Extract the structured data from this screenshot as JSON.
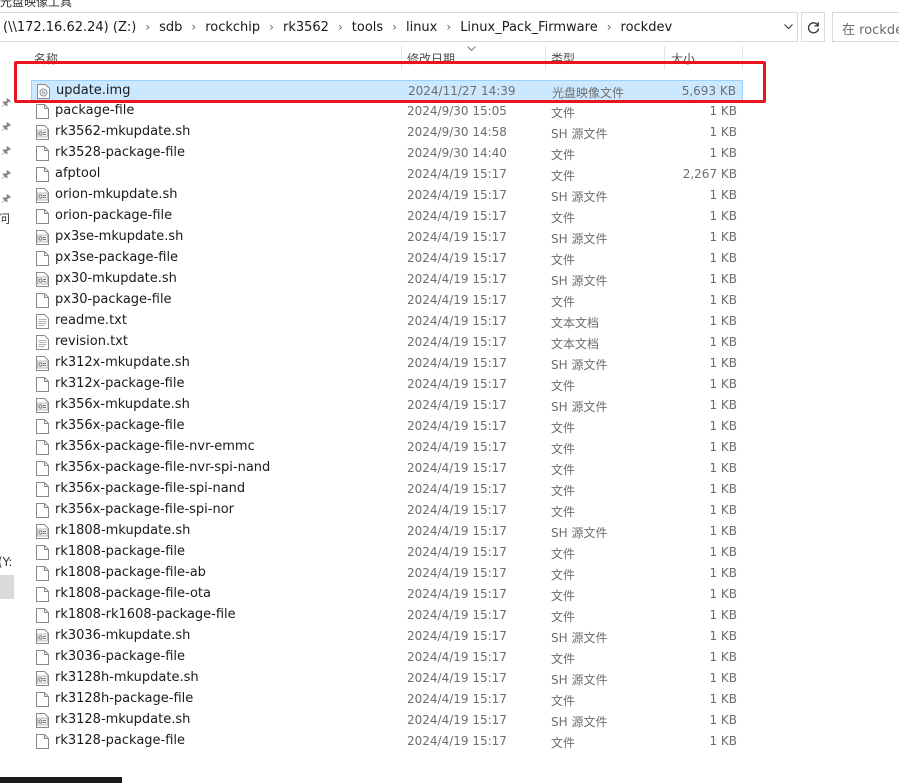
{
  "address_bar": {
    "crumbs": [
      "(\\\\172.16.62.24) (Z:)",
      "sdb",
      "rockchip",
      "rk3562",
      "tools",
      "linux",
      "Linux_Pack_Firmware",
      "rockdev"
    ],
    "search_placeholder": "在 rockdev 中搜索"
  },
  "top_cut_text": "光盘映像工具",
  "left_cut_texts": [
    "问",
    "(Y:"
  ],
  "columns": {
    "name": "名称",
    "date": "修改日期",
    "type": "类型",
    "size": "大小"
  },
  "files": [
    {
      "name": "update.img",
      "date": "2024/11/27 14:39",
      "type": "光盘映像文件",
      "size": "5,693 KB",
      "icon": "disc-image-icon",
      "selected": true
    },
    {
      "name": "package-file",
      "date": "2024/9/30 15:05",
      "type": "文件",
      "size": "1 KB",
      "icon": "file-icon"
    },
    {
      "name": "rk3562-mkupdate.sh",
      "date": "2024/9/30 14:58",
      "type": "SH 源文件",
      "size": "1 KB",
      "icon": "script-icon"
    },
    {
      "name": "rk3528-package-file",
      "date": "2024/9/30 14:40",
      "type": "文件",
      "size": "1 KB",
      "icon": "file-icon"
    },
    {
      "name": "afptool",
      "date": "2024/4/19 15:17",
      "type": "文件",
      "size": "2,267 KB",
      "icon": "file-icon"
    },
    {
      "name": "orion-mkupdate.sh",
      "date": "2024/4/19 15:17",
      "type": "SH 源文件",
      "size": "1 KB",
      "icon": "script-icon"
    },
    {
      "name": "orion-package-file",
      "date": "2024/4/19 15:17",
      "type": "文件",
      "size": "1 KB",
      "icon": "file-icon"
    },
    {
      "name": "px3se-mkupdate.sh",
      "date": "2024/4/19 15:17",
      "type": "SH 源文件",
      "size": "1 KB",
      "icon": "script-icon"
    },
    {
      "name": "px3se-package-file",
      "date": "2024/4/19 15:17",
      "type": "文件",
      "size": "1 KB",
      "icon": "file-icon"
    },
    {
      "name": "px30-mkupdate.sh",
      "date": "2024/4/19 15:17",
      "type": "SH 源文件",
      "size": "1 KB",
      "icon": "script-icon"
    },
    {
      "name": "px30-package-file",
      "date": "2024/4/19 15:17",
      "type": "文件",
      "size": "1 KB",
      "icon": "file-icon"
    },
    {
      "name": "readme.txt",
      "date": "2024/4/19 15:17",
      "type": "文本文档",
      "size": "1 KB",
      "icon": "text-document-icon"
    },
    {
      "name": "revision.txt",
      "date": "2024/4/19 15:17",
      "type": "文本文档",
      "size": "1 KB",
      "icon": "text-document-icon"
    },
    {
      "name": "rk312x-mkupdate.sh",
      "date": "2024/4/19 15:17",
      "type": "SH 源文件",
      "size": "1 KB",
      "icon": "script-icon"
    },
    {
      "name": "rk312x-package-file",
      "date": "2024/4/19 15:17",
      "type": "文件",
      "size": "1 KB",
      "icon": "file-icon"
    },
    {
      "name": "rk356x-mkupdate.sh",
      "date": "2024/4/19 15:17",
      "type": "SH 源文件",
      "size": "1 KB",
      "icon": "script-icon"
    },
    {
      "name": "rk356x-package-file",
      "date": "2024/4/19 15:17",
      "type": "文件",
      "size": "1 KB",
      "icon": "file-icon"
    },
    {
      "name": "rk356x-package-file-nvr-emmc",
      "date": "2024/4/19 15:17",
      "type": "文件",
      "size": "1 KB",
      "icon": "file-icon"
    },
    {
      "name": "rk356x-package-file-nvr-spi-nand",
      "date": "2024/4/19 15:17",
      "type": "文件",
      "size": "1 KB",
      "icon": "file-icon"
    },
    {
      "name": "rk356x-package-file-spi-nand",
      "date": "2024/4/19 15:17",
      "type": "文件",
      "size": "1 KB",
      "icon": "file-icon"
    },
    {
      "name": "rk356x-package-file-spi-nor",
      "date": "2024/4/19 15:17",
      "type": "文件",
      "size": "1 KB",
      "icon": "file-icon"
    },
    {
      "name": "rk1808-mkupdate.sh",
      "date": "2024/4/19 15:17",
      "type": "SH 源文件",
      "size": "1 KB",
      "icon": "script-icon"
    },
    {
      "name": "rk1808-package-file",
      "date": "2024/4/19 15:17",
      "type": "文件",
      "size": "1 KB",
      "icon": "file-icon"
    },
    {
      "name": "rk1808-package-file-ab",
      "date": "2024/4/19 15:17",
      "type": "文件",
      "size": "1 KB",
      "icon": "file-icon"
    },
    {
      "name": "rk1808-package-file-ota",
      "date": "2024/4/19 15:17",
      "type": "文件",
      "size": "1 KB",
      "icon": "file-icon"
    },
    {
      "name": "rk1808-rk1608-package-file",
      "date": "2024/4/19 15:17",
      "type": "文件",
      "size": "1 KB",
      "icon": "file-icon"
    },
    {
      "name": "rk3036-mkupdate.sh",
      "date": "2024/4/19 15:17",
      "type": "SH 源文件",
      "size": "1 KB",
      "icon": "script-icon"
    },
    {
      "name": "rk3036-package-file",
      "date": "2024/4/19 15:17",
      "type": "文件",
      "size": "1 KB",
      "icon": "file-icon"
    },
    {
      "name": "rk3128h-mkupdate.sh",
      "date": "2024/4/19 15:17",
      "type": "SH 源文件",
      "size": "1 KB",
      "icon": "script-icon"
    },
    {
      "name": "rk3128h-package-file",
      "date": "2024/4/19 15:17",
      "type": "文件",
      "size": "1 KB",
      "icon": "file-icon"
    },
    {
      "name": "rk3128-mkupdate.sh",
      "date": "2024/4/19 15:17",
      "type": "SH 源文件",
      "size": "1 KB",
      "icon": "script-icon"
    },
    {
      "name": "rk3128-package-file",
      "date": "2024/4/19 15:17",
      "type": "文件",
      "size": "1 KB",
      "icon": "file-icon"
    }
  ],
  "colors": {
    "selection_bg": "#cce8ff",
    "selection_border": "#99d1ff",
    "highlight_red": "#e8141e"
  }
}
